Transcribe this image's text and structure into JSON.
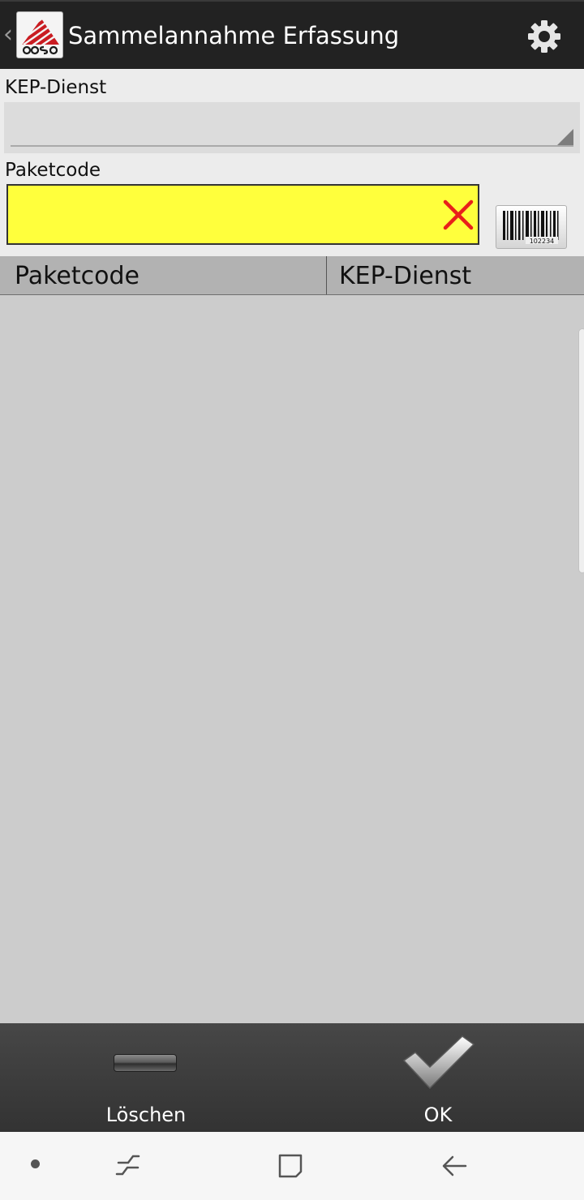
{
  "app": {
    "title": "Sammelannahme Erfassung",
    "logo_icon": "app-logo-icon",
    "back_icon": "chevron-left-icon",
    "settings_icon": "gear-icon"
  },
  "form": {
    "kep_label": "KEP-Dienst",
    "kep_selected": "",
    "paketcode_label": "Paketcode",
    "paketcode_value": "",
    "paketcode_bg": "#ffff3c",
    "clear_icon": "close-icon",
    "scan_icon": "barcode-icon",
    "barcode_caption": "102234"
  },
  "table": {
    "columns": [
      "Paketcode",
      "KEP-Dienst"
    ],
    "rows": []
  },
  "bottom_bar": {
    "delete_label": "Löschen",
    "delete_icon": "minus-icon",
    "ok_label": "OK",
    "ok_icon": "checkmark-icon"
  },
  "system_nav": {
    "items": [
      "dot-icon",
      "recents-icon",
      "home-icon",
      "back-arrow-icon"
    ]
  },
  "colors": {
    "actionbar": "#222222",
    "form_bg": "#ececec",
    "input_highlight": "#ffff3c",
    "clear_x": "#e8201a",
    "table_header": "#b2b2b2",
    "table_body": "#cccccc",
    "button_bar": "#3d3d3d"
  }
}
